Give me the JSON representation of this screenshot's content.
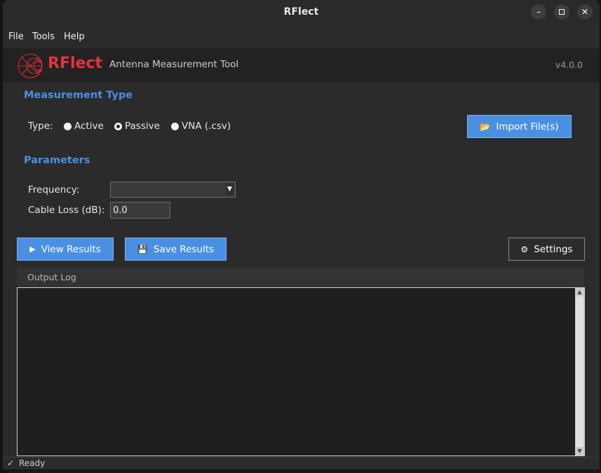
{
  "window": {
    "title": "RFlect",
    "minimize_icon": "minimize-icon",
    "maximize_icon": "maximize-icon",
    "close_icon": "close-icon"
  },
  "menubar": {
    "items": [
      "File",
      "Tools",
      "Help"
    ]
  },
  "header": {
    "logo_icon": "smith-chart-logo-icon",
    "brand": "RFlect",
    "tagline": "Antenna Measurement Tool",
    "version": "v4.0.0"
  },
  "measurement": {
    "section_title": "Measurement Type",
    "type_label": "Type:",
    "options": [
      {
        "label": "Active",
        "selected": false
      },
      {
        "label": "Passive",
        "selected": true
      },
      {
        "label": "VNA (.csv)",
        "selected": false
      }
    ],
    "import_button": {
      "icon": "folder-open-icon",
      "glyph": "📂",
      "label": "Import File(s)"
    }
  },
  "parameters": {
    "section_title": "Parameters",
    "frequency_label": "Frequency:",
    "frequency_value": "",
    "cable_loss_label": "Cable Loss (dB):",
    "cable_loss_value": "0.0"
  },
  "actions": {
    "view_results": {
      "icon": "play-icon",
      "glyph": "▶",
      "label": "View Results"
    },
    "save_results": {
      "icon": "floppy-disk-icon",
      "glyph": "💾",
      "label": "Save Results"
    },
    "settings": {
      "icon": "gear-icon",
      "glyph": "⚙",
      "label": "Settings"
    }
  },
  "output_log": {
    "title": "Output Log",
    "content": ""
  },
  "status_bar": {
    "icon": "checkmark-icon",
    "glyph": "✓",
    "text": "Ready"
  },
  "colors": {
    "accent_blue": "#4a90e2",
    "brand_red": "#e8323e",
    "background": "#2b2b2b",
    "header_bg": "#222222"
  }
}
